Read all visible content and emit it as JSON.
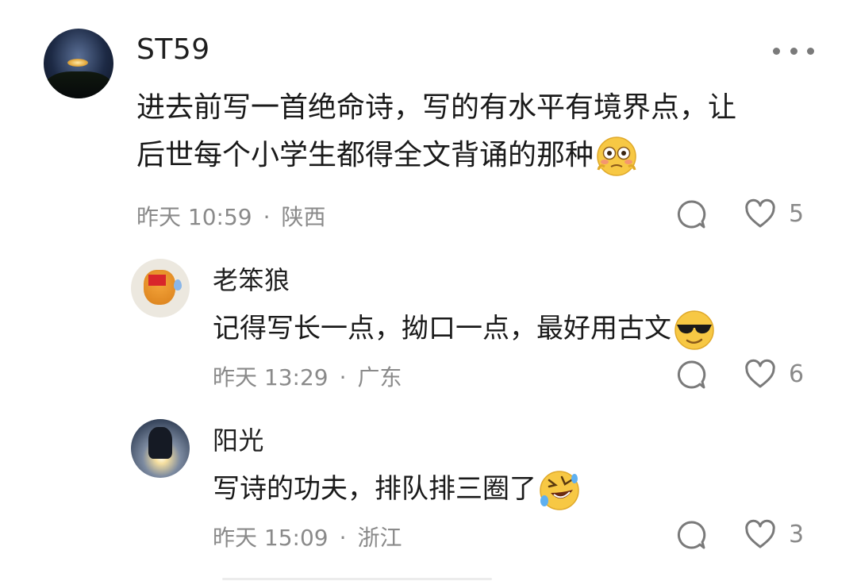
{
  "comments": [
    {
      "username": "ST59",
      "text": "进去前写一首绝命诗，写的有水平有境界点，让",
      "text_line2": "后世每个小学生都得全文背诵的那种",
      "emoji_icon": "flushed-face-icon",
      "time": "昨天 10:59",
      "location": "陕西",
      "likes": "5"
    },
    {
      "username": "老笨狼",
      "text": "记得写长一点，拗口一点，最好用古文",
      "emoji_icon": "sunglasses-face-icon",
      "time": "昨天 13:29",
      "location": "广东",
      "likes": "6"
    },
    {
      "username": "阳光",
      "text": "写诗的功夫，排队排三圈了",
      "emoji_icon": "rolling-laughing-face-icon",
      "time": "昨天 15:09",
      "location": "浙江",
      "likes": "3"
    }
  ],
  "separator": "·",
  "colors": {
    "meta_text": "#8a8a8a",
    "icon_stroke": "#7a7a7a",
    "emoji_yellow": "#f7c844"
  }
}
